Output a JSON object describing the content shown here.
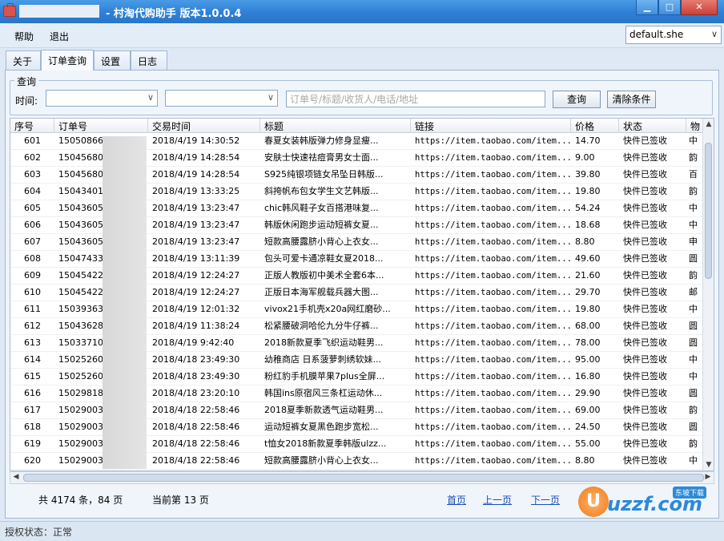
{
  "window": {
    "title": "- 村淘代购助手  版本1.0.0.4",
    "buttons": [
      "▁",
      "□",
      "✕"
    ]
  },
  "menu": {
    "items": [
      "帮助",
      "退出"
    ]
  },
  "profile_select": {
    "value": "default.she"
  },
  "tabs": [
    "关于",
    "订单查询",
    "设置",
    "日志"
  ],
  "active_tab": 1,
  "query": {
    "group_label": "查询",
    "time_label": "时间:",
    "search_placeholder": "订单号/标题/收货人/电话/地址",
    "search_button": "查询",
    "clear_button": "清除条件"
  },
  "table": {
    "columns": [
      "序号",
      "订单号",
      "交易时间",
      "标题",
      "链接",
      "价格",
      "状态",
      "物"
    ],
    "rows": [
      [
        "601",
        "150508660",
        "2018/4/19 14:30:52",
        "春夏女装韩版弹力修身显瘦...",
        "https://item.taobao.com/item...",
        "14.70",
        "快件已签收",
        "中"
      ],
      [
        "602",
        "150456807",
        "2018/4/19 14:28:54",
        "安肤士快速祛痘膏男女士面...",
        "https://item.taobao.com/item...",
        "9.00",
        "快件已签收",
        "韵"
      ],
      [
        "603",
        "150456807",
        "2018/4/19 14:28:54",
        "S925纯银项链女吊坠日韩版...",
        "https://item.taobao.com/item...",
        "39.80",
        "快件已签收",
        "百"
      ],
      [
        "604",
        "150434015",
        "2018/4/19 13:33:25",
        "斜挎帆布包女学生文艺韩版...",
        "https://item.taobao.com/item...",
        "19.80",
        "快件已签收",
        "韵"
      ],
      [
        "605",
        "150436058",
        "2018/4/19 13:23:47",
        "chic韩风鞋子女百搭港味复...",
        "https://item.taobao.com/item...",
        "54.24",
        "快件已签收",
        "中"
      ],
      [
        "606",
        "150436058",
        "2018/4/19 13:23:47",
        "韩版休闲跑步运动短裤女夏...",
        "https://item.taobao.com/item...",
        "18.68",
        "快件已签收",
        "中"
      ],
      [
        "607",
        "150436058",
        "2018/4/19 13:23:47",
        "短款高腰露脐小背心上衣女...",
        "https://item.taobao.com/item...",
        "8.80",
        "快件已签收",
        "申"
      ],
      [
        "608",
        "150474332",
        "2018/4/19 13:11:39",
        "包头可爱卡通凉鞋女夏2018...",
        "https://item.taobao.com/item...",
        "49.60",
        "快件已签收",
        "圆"
      ],
      [
        "609",
        "150454228",
        "2018/4/19 12:24:27",
        "正版人教版初中美术全套6本...",
        "https://item.taobao.com/item...",
        "21.60",
        "快件已签收",
        "韵"
      ],
      [
        "610",
        "150454228",
        "2018/4/19 12:24:27",
        "正版日本海军舰载兵器大图...",
        "https://item.taobao.com/item...",
        "29.70",
        "快件已签收",
        "邮"
      ],
      [
        "611",
        "150393639",
        "2018/4/19 12:01:32",
        "vivox21手机壳x20a网红磨砂...",
        "https://item.taobao.com/item...",
        "19.80",
        "快件已签收",
        "中"
      ],
      [
        "612",
        "150436280",
        "2018/4/19 11:38:24",
        "松紧腰破洞哈伦九分牛仔裤...",
        "https://item.taobao.com/item...",
        "68.00",
        "快件已签收",
        "圆"
      ],
      [
        "613",
        "150337106",
        "2018/4/19 9:42:40",
        "2018新款夏季飞织运动鞋男...",
        "https://item.taobao.com/item...",
        "78.00",
        "快件已签收",
        "圆"
      ],
      [
        "614",
        "150252603",
        "2018/4/18 23:49:30",
        "幼稚商店 日系菠萝刺绣软妹...",
        "https://item.taobao.com/item...",
        "95.00",
        "快件已签收",
        "中"
      ],
      [
        "615",
        "150252603",
        "2018/4/18 23:49:30",
        "粉红豹手机膜苹果7plus全屏...",
        "https://item.taobao.com/item...",
        "16.80",
        "快件已签收",
        "中"
      ],
      [
        "616",
        "150298184",
        "2018/4/18 23:20:10",
        "韩国ins原宿风三条杠运动休...",
        "https://item.taobao.com/item...",
        "29.90",
        "快件已签收",
        "圆"
      ],
      [
        "617",
        "150290036",
        "2018/4/18 22:58:46",
        "2018夏季新款透气运动鞋男...",
        "https://item.taobao.com/item...",
        "69.00",
        "快件已签收",
        "韵"
      ],
      [
        "618",
        "150290036",
        "2018/4/18 22:58:46",
        "运动短裤女夏黑色跑步宽松...",
        "https://item.taobao.com/item...",
        "24.50",
        "快件已签收",
        "圆"
      ],
      [
        "619",
        "150290036",
        "2018/4/18 22:58:46",
        "t恤女2018新款夏季韩版ulzz...",
        "https://item.taobao.com/item...",
        "55.00",
        "快件已签收",
        "韵"
      ],
      [
        "620",
        "150290036",
        "2018/4/18 22:58:46",
        "短款高腰露脐小背心上衣女...",
        "https://item.taobao.com/item...",
        "8.80",
        "快件已签收",
        "中"
      ]
    ]
  },
  "pager": {
    "total": "共 4174 条，84 页",
    "current": "当前第 13 页",
    "first": "首页",
    "prev": "上一页",
    "next": "下一页"
  },
  "watermark": {
    "letter": "U",
    "word": "uzzf.com",
    "tag": "东坡下载"
  },
  "status": {
    "text": "授权状态：正常"
  }
}
